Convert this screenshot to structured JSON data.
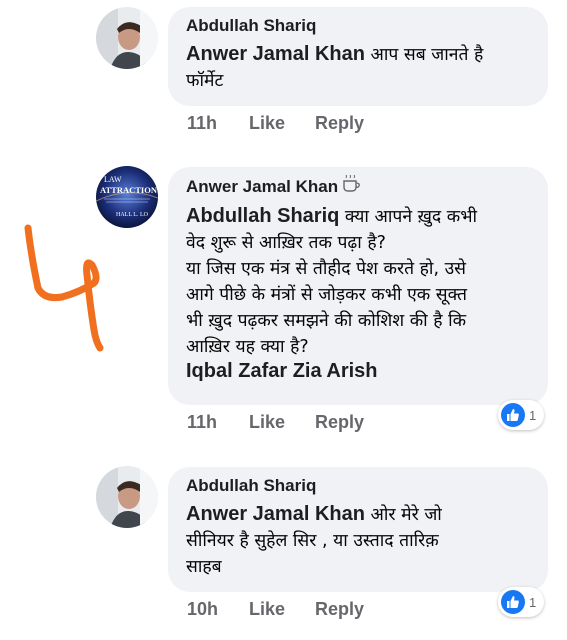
{
  "comments": [
    {
      "author": "Abdullah Shariq",
      "mention": "Anwer Jamal Khan",
      "text": " आप सब जानते है\nफॉर्मेट",
      "time": "11h",
      "like_label": "Like",
      "reply_label": "Reply"
    },
    {
      "author": "Anwer Jamal Khan",
      "author_icon": "coffee-cup-icon",
      "avatar_text_top": "LAW",
      "avatar_text_mid": "ATTRACTION",
      "avatar_text_bottom": "HALL L. LO",
      "mention": "Abdullah Shariq",
      "text": " क्या आपने ख़ुद कभी\nवेद शुरू से आख़िर तक पढ़ा है?\nया जिस एक मंत्र से तौहीद पेश करते हो, उसे\nआगे पीछे के मंत्रों से जोड़कर कभी एक सूक्त\nभी ख़ुद पढ़कर समझने की कोशिश की है कि\nआख़िर यह क्या है?",
      "tag": "Iqbal Zafar Zia Arish",
      "time": "11h",
      "like_label": "Like",
      "reply_label": "Reply",
      "reaction_count": "1"
    },
    {
      "author": "Abdullah Shariq",
      "mention": "Anwer Jamal Khan",
      "text": " ओर मेरे जो\nसीनियर है सुहेल सिर , या उस्ताद तारिक़\nसाहब",
      "time": "10h",
      "like_label": "Like",
      "reply_label": "Reply",
      "reaction_count": "1"
    }
  ],
  "colors": {
    "bubble": "#f0f2f5",
    "meta_text": "#65676b",
    "like_blue": "#1877f2",
    "scribble": "#f07020"
  },
  "annotation": "4"
}
